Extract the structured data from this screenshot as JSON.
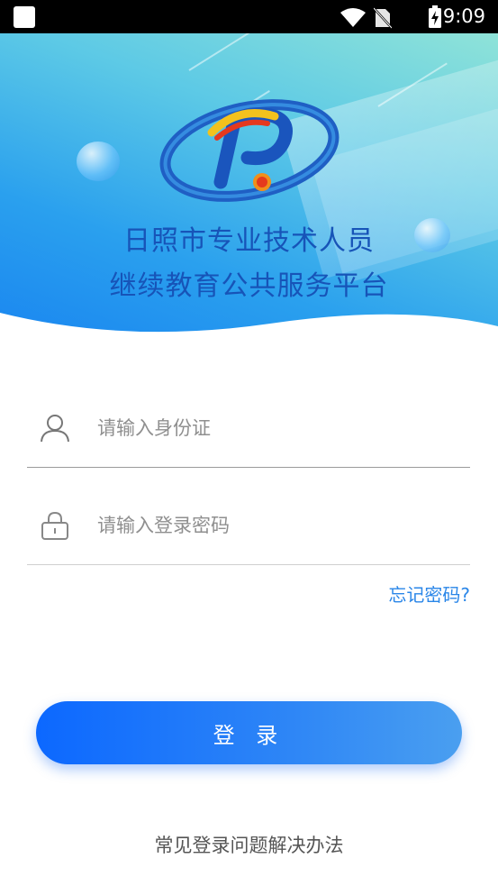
{
  "status_bar": {
    "time": "9:09",
    "icons": [
      "app-square-icon",
      "wifi-icon",
      "no-sim-icon",
      "battery-charging-icon"
    ]
  },
  "header": {
    "title_line1": "日照市专业技术人员",
    "title_line2": "继续教育公共服务平台",
    "logo_icon": "p-logo-icon"
  },
  "form": {
    "id_field": {
      "placeholder": "请输入身份证",
      "value": "",
      "icon": "user-icon"
    },
    "password_field": {
      "placeholder": "请输入登录密码",
      "value": "",
      "icon": "lock-icon"
    },
    "forgot_label": "忘记密码?",
    "login_label": "登 录"
  },
  "footer": {
    "help_label": "常见登录问题解决办法"
  },
  "colors": {
    "accent": "#1a7cf5",
    "title": "#1754b8",
    "link": "#2a86e8"
  }
}
